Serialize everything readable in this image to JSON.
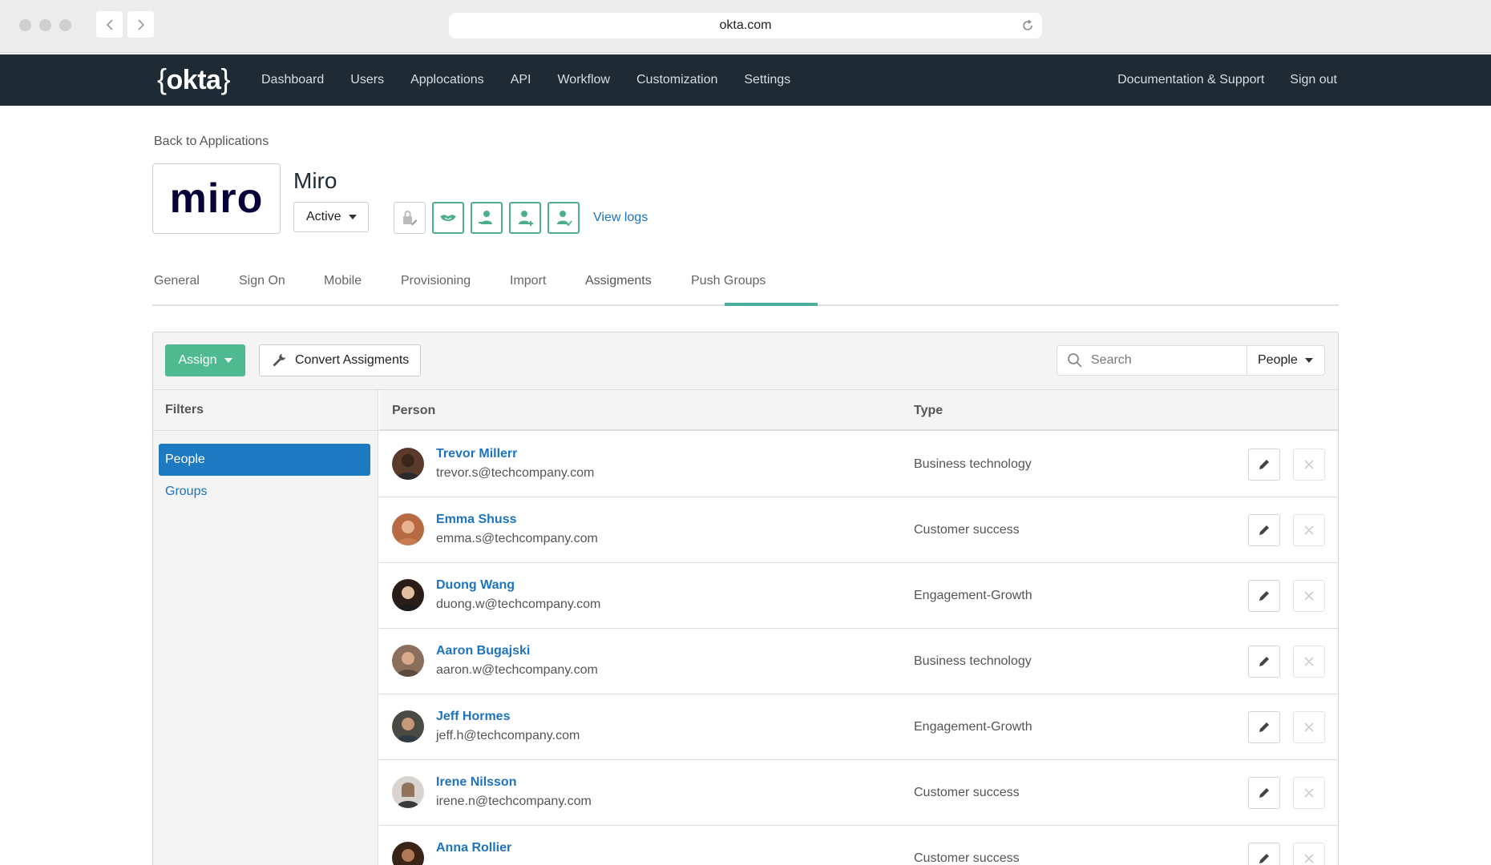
{
  "browser": {
    "url": "okta.com"
  },
  "nav": {
    "logo": "okta",
    "links": [
      "Dashboard",
      "Users",
      "Applocations",
      "API",
      "Workflow",
      "Customization",
      "Settings"
    ],
    "right": [
      "Documentation & Support",
      "Sign out"
    ]
  },
  "app": {
    "back_label": "Back to Applications",
    "logo_text": "miro",
    "name": "Miro",
    "status": "Active",
    "view_logs": "View logs"
  },
  "tabs": [
    "General",
    "Sign On",
    "Mobile",
    "Provisioning",
    "Import",
    "Assigments",
    "Push Groups"
  ],
  "active_tab": "Assigments",
  "toolbar": {
    "assign_label": "Assign",
    "convert_label": "Convert Assigments",
    "search_placeholder": "Search",
    "search_scope": "People"
  },
  "filters": {
    "header": "Filters",
    "items": [
      "People",
      "Groups"
    ],
    "active": "People"
  },
  "table": {
    "columns": [
      "Person",
      "Type"
    ],
    "rows": [
      {
        "name": "Trevor Millerr",
        "email": "trevor.s@techcompany.com",
        "type": "Business technology"
      },
      {
        "name": "Emma Shuss",
        "email": "emma.s@techcompany.com",
        "type": "Customer success"
      },
      {
        "name": "Duong Wang",
        "email": "duong.w@techcompany.com",
        "type": "Engagement-Growth"
      },
      {
        "name": "Aaron Bugajski",
        "email": "aaron.w@techcompany.com",
        "type": "Business technology"
      },
      {
        "name": "Jeff Hormes",
        "email": "jeff.h@techcompany.com",
        "type": "Engagement-Growth"
      },
      {
        "name": "Irene Nilsson",
        "email": "irene.n@techcompany.com",
        "type": "Customer success"
      },
      {
        "name": "Anna Rollier",
        "email": "",
        "type": "Customer success"
      }
    ]
  },
  "colors": {
    "nav_bg": "#1e2a34",
    "accent_green": "#4fba8f",
    "link_blue": "#1e73be",
    "filter_active": "#1e7ac0"
  },
  "icons": [
    "back-arrow-icon",
    "forward-arrow-icon",
    "reload-icon",
    "lock-pen-icon",
    "handshake-icon",
    "user-push-icon",
    "user-add-icon",
    "user-check-icon",
    "wrench-icon",
    "search-icon",
    "pencil-icon",
    "close-icon"
  ]
}
